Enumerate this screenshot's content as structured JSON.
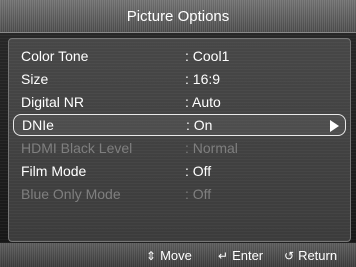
{
  "header": {
    "title": "Picture Options"
  },
  "menu": {
    "items": [
      {
        "label": "Color Tone",
        "value": ": Cool1",
        "state": "normal"
      },
      {
        "label": "Size",
        "value": ": 16:9",
        "state": "normal"
      },
      {
        "label": "Digital NR",
        "value": ": Auto",
        "state": "normal"
      },
      {
        "label": "DNIe",
        "value": ": On",
        "state": "selected"
      },
      {
        "label": "HDMI Black Level",
        "value": ": Normal",
        "state": "disabled"
      },
      {
        "label": "Film Mode",
        "value": ": Off",
        "state": "normal"
      },
      {
        "label": "Blue Only Mode",
        "value": ": Off",
        "state": "disabled"
      }
    ]
  },
  "footer": {
    "move": {
      "icon": "up-down-arrows-icon",
      "label": "Move"
    },
    "enter": {
      "icon": "enter-icon",
      "label": "Enter"
    },
    "return": {
      "icon": "return-arrow-icon",
      "label": "Return"
    }
  }
}
